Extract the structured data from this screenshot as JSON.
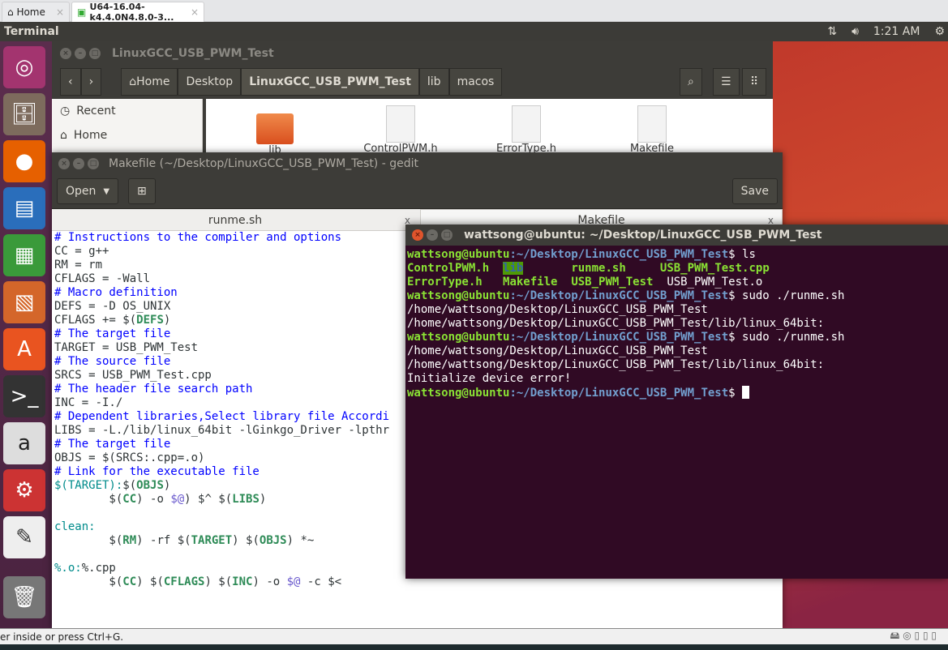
{
  "vmware": {
    "tabs": [
      {
        "label": "Home",
        "icon": "home-icon"
      },
      {
        "label": "U64-16.04-k4.4.0N4.8.0-3...",
        "icon": "vm-icon"
      }
    ],
    "status": "er inside or press Ctrl+G."
  },
  "panel": {
    "app_name": "Terminal",
    "time": "1:21 AM",
    "icons": [
      "network-icon",
      "volume-icon",
      "power-gear-icon"
    ]
  },
  "launcher": {
    "items": [
      "ubuntu-dash-icon",
      "files-icon",
      "firefox-icon",
      "writer-icon",
      "calc-icon",
      "impress-icon",
      "software-center-icon",
      "terminal-icon",
      "amazon-icon",
      "settings-icon",
      "text-editor-icon",
      "trash-icon"
    ]
  },
  "nautilus": {
    "title": "LinuxGCC_USB_PWM_Test",
    "path": [
      "Home",
      "Desktop",
      "LinuxGCC_USB_PWM_Test",
      "lib",
      "macos"
    ],
    "sidebar": [
      "Recent",
      "Home"
    ],
    "files": [
      "lib",
      "ControlPWM.h",
      "ErrorType.h",
      "Makefile"
    ]
  },
  "gedit": {
    "title": "Makefile (~/Desktop/LinuxGCC_USB_PWM_Test) - gedit",
    "open_label": "Open",
    "save_label": "Save",
    "tabs": [
      "runme.sh",
      "Makefile"
    ],
    "lines": [
      [
        [
          "cm",
          "# Instructions to the compiler and options"
        ]
      ],
      [
        [
          "",
          "CC = g++"
        ]
      ],
      [
        [
          "",
          "RM = rm"
        ]
      ],
      [
        [
          "",
          "CFLAGS = -Wall"
        ]
      ],
      [
        [
          "cm",
          "# Macro definition"
        ]
      ],
      [
        [
          "",
          "DEFS = -D OS_UNIX"
        ]
      ],
      [
        [
          "",
          "CFLAGS += $("
        ],
        [
          "kw",
          "DEFS"
        ],
        [
          "",
          ")"
        ]
      ],
      [
        [
          "cm",
          "# The target file"
        ]
      ],
      [
        [
          "",
          "TARGET = USB_PWM_Test"
        ]
      ],
      [
        [
          "cm",
          "# The source file"
        ]
      ],
      [
        [
          "",
          "SRCS = USB_PWM_Test.cpp"
        ]
      ],
      [
        [
          "cm",
          "# The header file search path"
        ]
      ],
      [
        [
          "",
          "INC = -I./"
        ]
      ],
      [
        [
          "cm",
          "# Dependent libraries,Select library file Accordi"
        ]
      ],
      [
        [
          "",
          "LIBS = -L./lib/linux_64bit -lGinkgo_Driver -lpthr"
        ]
      ],
      [
        [
          "cm",
          "# The target file"
        ]
      ],
      [
        [
          "",
          "OBJS = $(SRCS:.cpp=.o)"
        ]
      ],
      [
        [
          "cm",
          "# Link for the executable file"
        ]
      ],
      [
        [
          "tg",
          "$(TARGET):"
        ],
        [
          "",
          "$("
        ],
        [
          "kw",
          "OBJS"
        ],
        [
          "",
          ")"
        ]
      ],
      [
        [
          "",
          "        $("
        ],
        [
          "kw",
          "CC"
        ],
        [
          "",
          ") -o "
        ],
        [
          "pv",
          "$@"
        ],
        [
          "",
          ") $^ $("
        ],
        [
          "kw",
          "LIBS"
        ],
        [
          "",
          ")"
        ]
      ],
      [
        [
          "",
          ""
        ]
      ],
      [
        [
          "tg",
          "clean:"
        ]
      ],
      [
        [
          "",
          "        $("
        ],
        [
          "kw",
          "RM"
        ],
        [
          "",
          ") -rf $("
        ],
        [
          "kw",
          "TARGET"
        ],
        [
          "",
          ") $("
        ],
        [
          "kw",
          "OBJS"
        ],
        [
          "",
          ") *~"
        ]
      ],
      [
        [
          "",
          ""
        ]
      ],
      [
        [
          "tg",
          "%.o:"
        ],
        [
          "",
          "%.cpp"
        ]
      ],
      [
        [
          "",
          "        $("
        ],
        [
          "kw",
          "CC"
        ],
        [
          "",
          ") $("
        ],
        [
          "kw",
          "CFLAGS"
        ],
        [
          "",
          ") $("
        ],
        [
          "kw",
          "INC"
        ],
        [
          "",
          ") -o "
        ],
        [
          "pv",
          "$@"
        ],
        [
          "",
          " -c $<"
        ]
      ]
    ]
  },
  "terminal": {
    "title": "wattsong@ubuntu: ~/Desktop/LinuxGCC_USB_PWM_Test",
    "prompt_user": "wattsong@ubuntu",
    "prompt_path": ":~/Desktop/LinuxGCC_USB_PWM_Test",
    "prompt_end": "$ ",
    "cmd1": "ls",
    "ls": [
      [
        "ControlPWM.h  ",
        "ex"
      ],
      [
        "lib",
        "dir"
      ],
      [
        "       runme.sh     ",
        "ex"
      ],
      [
        "USB_PWM_Test.cpp",
        "ex"
      ],
      [
        "\n",
        ""
      ],
      [
        "ErrorType.h   ",
        "ex"
      ],
      [
        "Makefile  ",
        "ex"
      ],
      [
        "USB_PWM_Test  ",
        "ex"
      ],
      [
        "USB_PWM_Test.o",
        ""
      ]
    ],
    "cmd2": "sudo ./runme.sh",
    "out2": [
      "/home/wattsong/Desktop/LinuxGCC_USB_PWM_Test",
      "/home/wattsong/Desktop/LinuxGCC_USB_PWM_Test/lib/linux_64bit:"
    ],
    "cmd3": "sudo ./runme.sh",
    "out3": [
      "/home/wattsong/Desktop/LinuxGCC_USB_PWM_Test",
      "/home/wattsong/Desktop/LinuxGCC_USB_PWM_Test/lib/linux_64bit:",
      "Initialize device error!"
    ]
  },
  "colors": {
    "terminal_bg": "#300a24",
    "prompt_user": "#8ae234",
    "prompt_path": "#729fcf",
    "desktop": "#c0392b"
  }
}
